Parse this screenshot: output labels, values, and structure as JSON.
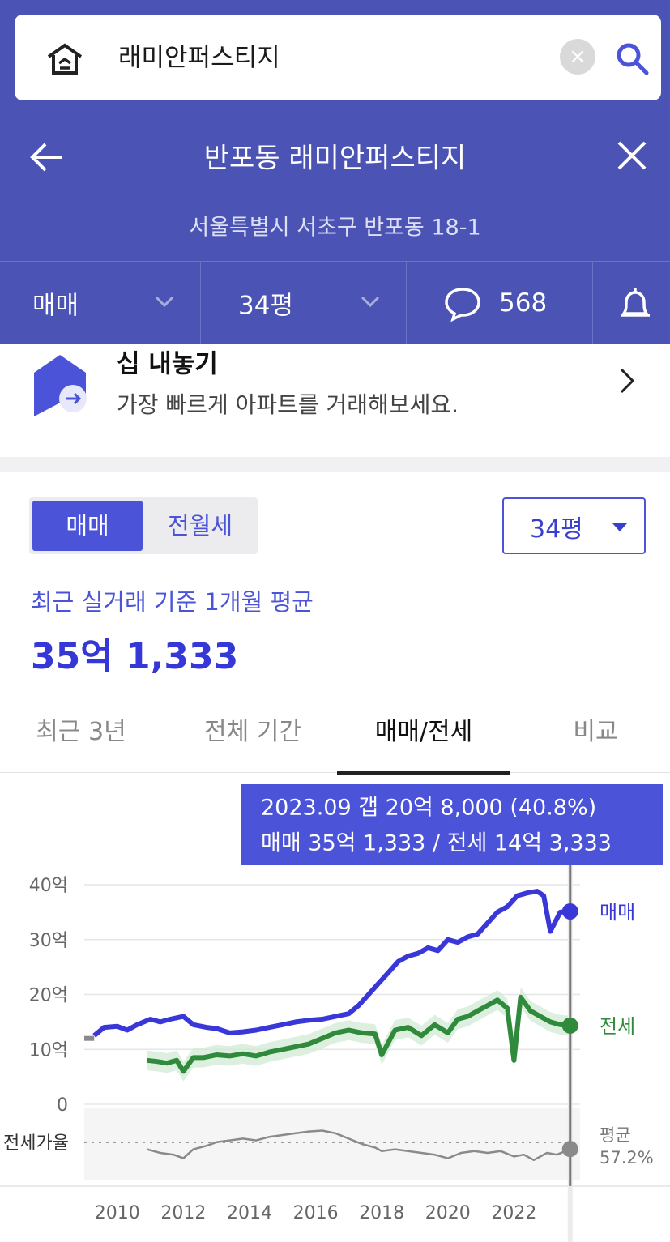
{
  "search": {
    "query": "래미안퍼스티지"
  },
  "nav": {
    "title": "반포동 래미안퍼스티지",
    "address": "서울특별시 서초구 반포동 18-1"
  },
  "filters": {
    "deal_type": "매매",
    "size": "34평",
    "comments": "568"
  },
  "banner": {
    "title": "십 내놓기",
    "subtitle": "가장 빠르게 아파트를 거래해보세요."
  },
  "segment": {
    "options": [
      "매매",
      "전월세"
    ],
    "selected": "매매"
  },
  "size_select": {
    "value": "34평"
  },
  "average": {
    "label": "최근 실거래 기준 1개월 평균",
    "value": "35억 1,333"
  },
  "tabs": [
    {
      "label": "최근 3년",
      "active": false
    },
    {
      "label": "전체 기간",
      "active": false
    },
    {
      "label": "매매/전세",
      "active": true
    },
    {
      "label": "비교",
      "active": false
    }
  ],
  "tooltip": {
    "line1": "2023.09  갭 20억 8,000 (40.8%)",
    "line2": "매매 35억 1,333 / 전세 14억 3,333"
  },
  "colors": {
    "header": "#4b53b5",
    "accent": "#4b53d9",
    "sale": "#3a37d8",
    "jeonse": "#2f8a3c",
    "ratio": "#8a8a8a"
  },
  "chart_data": {
    "type": "line",
    "y_ticks": [
      "40억",
      "30억",
      "20억",
      "10억",
      "0"
    ],
    "y_range": [
      0,
      40
    ],
    "x_ticks": [
      "2010",
      "2012",
      "2014",
      "2016",
      "2018",
      "2020",
      "2022"
    ],
    "x_range": [
      2009.0,
      2024.0
    ],
    "series": [
      {
        "name": "매매",
        "x": [
          2009.0,
          2009.3,
          2009.6,
          2010.0,
          2010.3,
          2010.6,
          2011.0,
          2011.3,
          2011.6,
          2012.0,
          2012.3,
          2012.7,
          2013.0,
          2013.4,
          2013.8,
          2014.2,
          2014.6,
          2015.0,
          2015.4,
          2015.8,
          2016.2,
          2016.6,
          2017.0,
          2017.3,
          2017.6,
          2017.9,
          2018.2,
          2018.5,
          2018.8,
          2019.1,
          2019.4,
          2019.7,
          2020.0,
          2020.3,
          2020.6,
          2020.9,
          2021.2,
          2021.5,
          2021.8,
          2022.1,
          2022.4,
          2022.7,
          2022.9,
          2023.1,
          2023.4,
          2023.7
        ],
        "values": [
          12.0,
          12.5,
          14.0,
          14.2,
          13.5,
          14.5,
          15.5,
          15.0,
          15.5,
          16.0,
          14.5,
          14.0,
          13.8,
          13.0,
          13.2,
          13.5,
          14.0,
          14.5,
          15.0,
          15.3,
          15.5,
          16.0,
          16.5,
          18.0,
          20.0,
          22.0,
          24.0,
          26.0,
          27.0,
          27.5,
          28.5,
          28.0,
          30.0,
          29.5,
          30.5,
          31.0,
          33.0,
          35.0,
          36.0,
          38.0,
          38.5,
          38.8,
          38.0,
          31.5,
          35.0,
          35.1333
        ]
      },
      {
        "name": "전세",
        "x": [
          2010.9,
          2011.2,
          2011.5,
          2011.8,
          2012.0,
          2012.3,
          2012.6,
          2013.0,
          2013.4,
          2013.8,
          2014.2,
          2014.6,
          2015.0,
          2015.4,
          2015.8,
          2016.2,
          2016.6,
          2017.0,
          2017.4,
          2017.8,
          2018.0,
          2018.4,
          2018.8,
          2019.2,
          2019.6,
          2020.0,
          2020.3,
          2020.6,
          2020.9,
          2021.2,
          2021.5,
          2021.8,
          2022.0,
          2022.2,
          2022.5,
          2022.8,
          2023.1,
          2023.4,
          2023.7
        ],
        "values": [
          8.0,
          7.8,
          7.5,
          8.0,
          6.0,
          8.5,
          8.5,
          9.0,
          8.8,
          9.2,
          8.8,
          9.5,
          10.0,
          10.5,
          11.0,
          12.0,
          13.0,
          13.5,
          13.0,
          12.8,
          9.0,
          13.5,
          14.0,
          12.5,
          14.5,
          13.0,
          15.5,
          16.0,
          17.0,
          18.0,
          19.0,
          17.5,
          8.0,
          19.5,
          17.0,
          16.0,
          15.0,
          14.5,
          14.3333
        ]
      },
      {
        "name": "전세가율",
        "x": [
          2010.9,
          2011.3,
          2011.7,
          2012.0,
          2012.3,
          2012.7,
          2013.0,
          2013.4,
          2013.8,
          2014.2,
          2014.6,
          2015.0,
          2015.4,
          2015.8,
          2016.2,
          2016.6,
          2017.0,
          2017.4,
          2017.8,
          2018.0,
          2018.4,
          2018.8,
          2019.2,
          2019.6,
          2020.0,
          2020.4,
          2020.8,
          2021.2,
          2021.6,
          2022.0,
          2022.3,
          2022.6,
          2023.0,
          2023.3,
          2023.7
        ],
        "values": [
          57.0,
          55.0,
          54.0,
          52.0,
          57.0,
          59.0,
          61.0,
          62.0,
          63.0,
          62.0,
          64.0,
          65.0,
          66.0,
          67.0,
          67.5,
          66.0,
          63.0,
          60.0,
          58.0,
          56.0,
          57.0,
          56.0,
          55.0,
          54.0,
          52.0,
          55.0,
          56.0,
          55.0,
          56.0,
          53.0,
          54.0,
          51.0,
          55.0,
          54.0,
          57.2
        ]
      }
    ],
    "series_labels": [
      "매매",
      "전세"
    ],
    "ratio_label": "전세가율",
    "ratio_avg_label": "평균",
    "ratio_avg_value": "57.2%",
    "selected_x": 2023.7
  }
}
